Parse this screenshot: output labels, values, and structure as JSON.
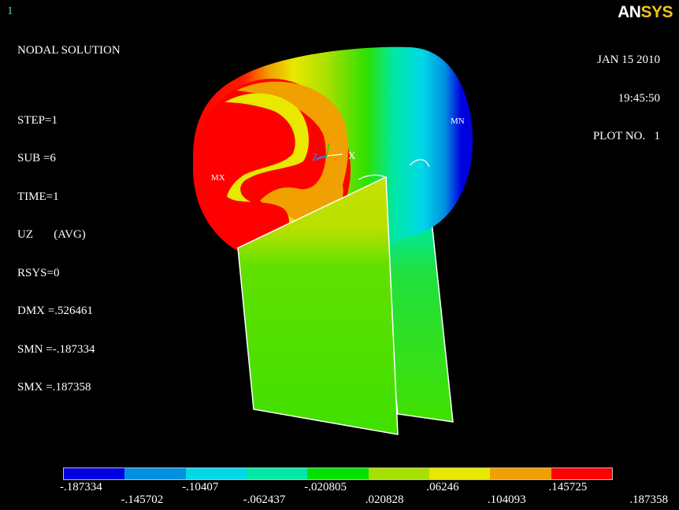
{
  "window_number": "1",
  "logo": {
    "an": "AN",
    "sys": "SYS"
  },
  "info": {
    "title": "NODAL SOLUTION",
    "step": "STEP=1",
    "sub": "SUB =6",
    "time": "TIME=1",
    "component": "UZ       (AVG)",
    "rsys": "RSYS=0",
    "dmx": "DMX =.526461",
    "smn": "SMN =-.187334",
    "smx": "SMX =.187358"
  },
  "date": {
    "date": "JAN 15 2010",
    "time": "19:45:50",
    "plot": "PLOT NO.   1"
  },
  "markers": {
    "max": "MX",
    "min": "MN"
  },
  "axes": {
    "z": "Z",
    "x": "X"
  },
  "legend": {
    "colors": [
      "#0000e0",
      "#0090e0",
      "#00d8e8",
      "#00e8a8",
      "#00e000",
      "#a8e000",
      "#e8e800",
      "#f0a000",
      "#ff0000"
    ],
    "labels_upper": [
      "-.187334",
      "-.10407",
      "-.020805",
      ".06246",
      ".145725"
    ],
    "labels_lower": [
      "-.145702",
      "-.062437",
      ".020828",
      ".104093",
      ".187358"
    ]
  }
}
